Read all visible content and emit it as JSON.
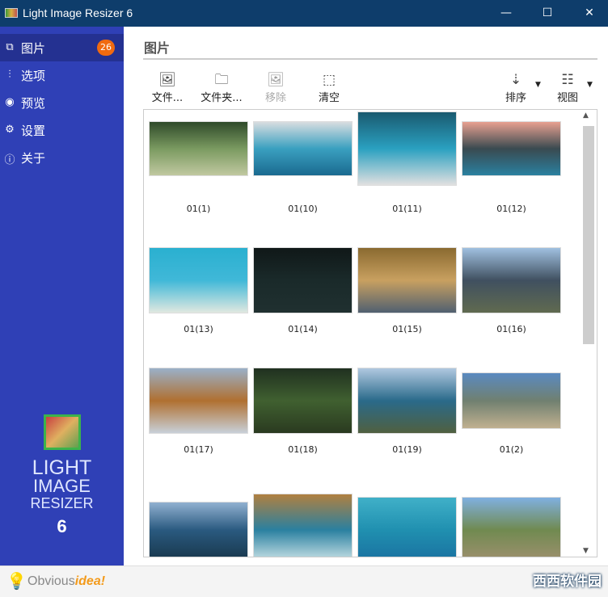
{
  "window": {
    "title": "Light Image Resizer 6",
    "minimize": "—",
    "maximize": "☐",
    "close": "✕"
  },
  "sidebar": {
    "items": [
      {
        "label": "图片",
        "icon": "images-icon",
        "glyph": "⧉",
        "badge": "26",
        "selected": true
      },
      {
        "label": "选项",
        "icon": "sliders-icon",
        "glyph": "⫶"
      },
      {
        "label": "预览",
        "icon": "eye-icon",
        "glyph": "◉"
      },
      {
        "label": "设置",
        "icon": "gear-icon",
        "glyph": "⚙"
      },
      {
        "label": "关于",
        "icon": "info-icon",
        "glyph": "ⓘ"
      }
    ],
    "logo": {
      "line1": "LIGHT",
      "line2": "IMAGE",
      "line3": "RESIZER",
      "line4": "6"
    }
  },
  "main": {
    "title": "图片",
    "toolbar": {
      "add_file": "文件...",
      "add_folder": "文件夹...",
      "remove": "移除",
      "clear": "清空",
      "sort": "排序",
      "view": "视图"
    },
    "thumbnails": [
      {
        "label": "01(1)",
        "colors": [
          "#2f4a2a",
          "#7a9a60",
          "#c0c8a0"
        ]
      },
      {
        "label": "01(10)",
        "colors": [
          "#d8dde0",
          "#3aa0c0",
          "#1a6a90"
        ]
      },
      {
        "label": "01(11)",
        "colors": [
          "#1a5a70",
          "#2aa0c0",
          "#e0e0e0"
        ]
      },
      {
        "label": "01(12)",
        "colors": [
          "#e8a090",
          "#3a4a50",
          "#2a80a0"
        ]
      },
      {
        "label": "01(13)",
        "colors": [
          "#2ab0d0",
          "#40b8d8",
          "#e0e8e0"
        ]
      },
      {
        "label": "01(14)",
        "colors": [
          "#101818",
          "#1a2a2a",
          "#203030"
        ]
      },
      {
        "label": "01(15)",
        "colors": [
          "#8a6a30",
          "#c8a060",
          "#506070"
        ]
      },
      {
        "label": "01(16)",
        "colors": [
          "#a0c0e0",
          "#405060",
          "#606a50"
        ]
      },
      {
        "label": "01(17)",
        "colors": [
          "#9ab0c8",
          "#b07030",
          "#c8d0d8"
        ]
      },
      {
        "label": "01(18)",
        "colors": [
          "#203020",
          "#406030",
          "#2a3a20"
        ]
      },
      {
        "label": "01(19)",
        "colors": [
          "#b0c8e0",
          "#2a6a8a",
          "#506040"
        ]
      },
      {
        "label": "01(2)",
        "colors": [
          "#5a8ac0",
          "#708070",
          "#c0b090"
        ]
      },
      {
        "label": "",
        "colors": [
          "#90b0d0",
          "#2a5a80",
          "#1a3a50"
        ]
      },
      {
        "label": "",
        "colors": [
          "#b08040",
          "#2a80a0",
          "#e0f0f0"
        ]
      },
      {
        "label": "",
        "colors": [
          "#40b0c8",
          "#2090b0",
          "#1a70a0"
        ]
      },
      {
        "label": "",
        "colors": [
          "#80b0e0",
          "#708a50",
          "#a09070"
        ]
      }
    ]
  },
  "footer": {
    "brand_plain": "Obvious",
    "brand_accent": "idea!",
    "watermark": "西西软件园"
  }
}
